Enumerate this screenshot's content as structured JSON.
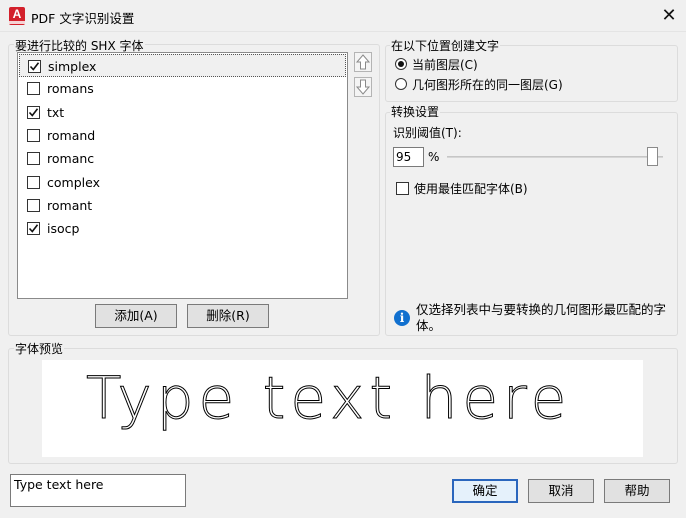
{
  "window": {
    "title": "PDF 文字识别设置",
    "icon": "autocad-icon",
    "app_icon_letter": "A",
    "close_glyph": "✕"
  },
  "fonts_group": {
    "label": "要进行比较的 SHX 字体",
    "items": [
      {
        "label": "simplex",
        "checked": true,
        "selected": true
      },
      {
        "label": "romans",
        "checked": false,
        "selected": false
      },
      {
        "label": "txt",
        "checked": true,
        "selected": false
      },
      {
        "label": "romand",
        "checked": false,
        "selected": false
      },
      {
        "label": "romanc",
        "checked": false,
        "selected": false
      },
      {
        "label": "complex",
        "checked": false,
        "selected": false
      },
      {
        "label": "romant",
        "checked": false,
        "selected": false
      },
      {
        "label": "isocp",
        "checked": true,
        "selected": false
      }
    ],
    "add_button": "添加(A)",
    "delete_button": "删除(R)"
  },
  "create_group": {
    "label": "在以下位置创建文字",
    "options": [
      {
        "label": "当前图层(C)",
        "selected": true
      },
      {
        "label": "几何图形所在的同一图层(G)",
        "selected": false
      }
    ]
  },
  "convert_group": {
    "label": "转换设置",
    "threshold_label": "识别阈值(T):",
    "threshold_value": "95",
    "percent_sign": "%",
    "best_match_label": "使用最佳匹配字体(B)",
    "best_match_checked": false,
    "info_text": "仅选择列表中与要转换的几何图形最匹配的字体。",
    "info_icon": "info-icon"
  },
  "preview_group": {
    "label": "字体预览",
    "preview_text": "Type text here"
  },
  "sample_input": {
    "value": "Type text here"
  },
  "buttons": {
    "ok": "确定",
    "cancel": "取消",
    "help": "帮助"
  },
  "colors": {
    "default_button_border": "#2a66bd",
    "info_blue": "#1170cf",
    "app_red": "#d3202b"
  }
}
